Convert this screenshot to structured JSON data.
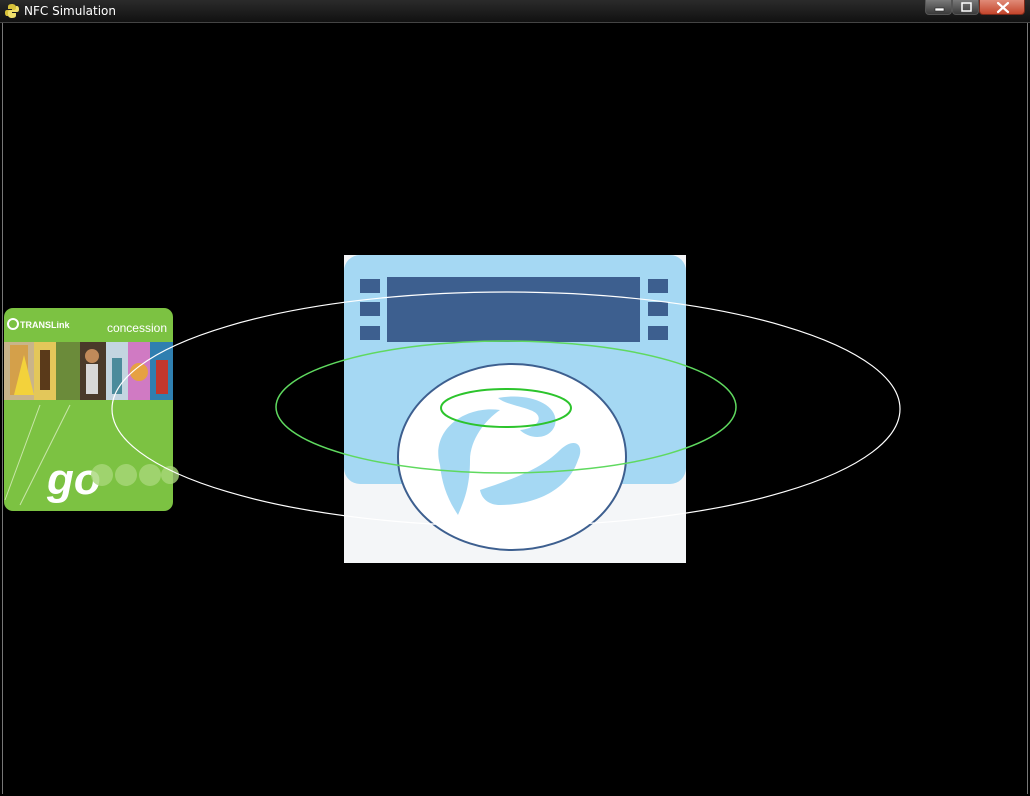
{
  "window": {
    "title": "NFC Simulation",
    "icon": "python-icon",
    "controls": {
      "minimize": "minimize-icon",
      "maximize": "maximize-icon",
      "close": "close-icon"
    }
  },
  "card": {
    "brand": "TRANSLink",
    "type_label": "concession",
    "logo_text": "go",
    "color": "#7cc242"
  },
  "reader": {
    "panel_color": "#a5d8f3",
    "display_color": "#3d5f8f",
    "base_color": "#f4f6f8"
  },
  "field": {
    "outer_ring_color": "#ffffff",
    "inner_ring_color": "#3ecb3e"
  }
}
